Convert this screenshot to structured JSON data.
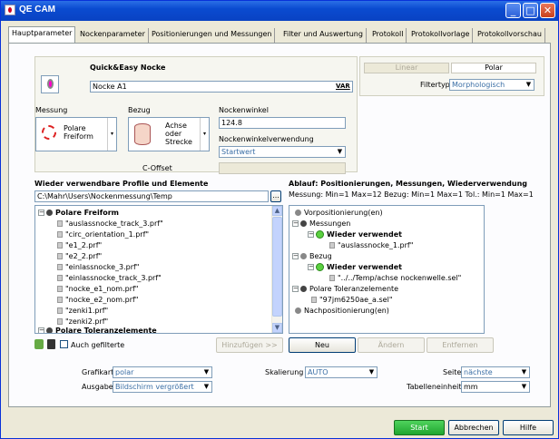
{
  "window": {
    "title": "QE CAM"
  },
  "tabs": [
    "Hauptparameter",
    "Nockenparameter",
    "Positionierungen und Messungen",
    "Filter und Auswertung",
    "Protokoll",
    "Protokollvorlage",
    "Protokollvorschau"
  ],
  "header": {
    "title": "Quick&Easy Nocke",
    "name_value": "Nocke A1",
    "var_label": "VAR",
    "mode_linear": "Linear",
    "mode_polar": "Polar",
    "filtertyp_label": "Filtertyp",
    "filtertyp_value": "Morphologisch"
  },
  "measure": {
    "messung_label": "Messung",
    "messung_line1": "Polare",
    "messung_line2": "Freiform",
    "bezug_label": "Bezug",
    "bezug_line1": "Achse",
    "bezug_line2": "oder",
    "bezug_line3": "Strecke",
    "nockenwinkel_label": "Nockenwinkel",
    "nockenwinkel_value": "124.8",
    "verwendung_label": "Nockenwinkelverwendung",
    "verwendung_value": "Startwert",
    "coffset_label": "C-Offset"
  },
  "left_list": {
    "title": "Wieder verwendbare Profile und Elemente",
    "path": "C:\\Mahr\\Users\\Nockenmessung\\Temp",
    "browse": "...",
    "group1": "Polare Freiform",
    "items": [
      "\"auslassnocke_track_3.prf\"",
      "\"circ_orientation_1.prf\"",
      "\"e1_2.prf\"",
      "\"e2_2.prf\"",
      "\"einlassnocke_3.prf\"",
      "\"einlassnocke_track_3.prf\"",
      "\"nocke_e1_nom.prf\"",
      "\"nocke_e2_nom.prf\"",
      "\"zenki1.prf\"",
      "\"zenki2.prf\""
    ],
    "group2": "Polare Toleranzelemente",
    "also_filtered": "Auch gefilterte",
    "add_button": "Hinzufügen >>"
  },
  "right_list": {
    "title": "Ablauf: Positionierungen, Messungen, Wiederverwendung",
    "subtitle": "Messung: Min=1 Max=12  Bezug: Min=1 Max=1  Tol.: Min=1 Max=1",
    "n1": "Vorpositionierung(en)",
    "n2": "Messungen",
    "n2a": "Wieder verwendet",
    "n2b": "\"auslassnocke_1.prf\"",
    "n3": "Bezug",
    "n3a": "Wieder verwendet",
    "n3b": "\"../../Temp/achse nockenwelle.sel\"",
    "n4": "Polare Toleranzelemente",
    "n4a": "\"97jm6250ae_a.sel\"",
    "n5": "Nachpositionierung(en)",
    "new_button": "Neu",
    "change_button": "Ändern",
    "remove_button": "Entfernen"
  },
  "bottom": {
    "grafikart_label": "Grafikart",
    "grafikart_value": "polar",
    "skalierung_label": "Skalierung",
    "skalierung_value": "AUTO",
    "seite_label": "Seite",
    "seite_value": "nächste",
    "ausgabe_label": "Ausgabe",
    "ausgabe_value": "Bildschirm vergrößert",
    "tabelleneinheit_label": "Tabelleneinheit",
    "tabelleneinheit_value": "mm"
  },
  "footer": {
    "start": "Start",
    "cancel": "Abbrechen",
    "help": "Hilfe"
  }
}
